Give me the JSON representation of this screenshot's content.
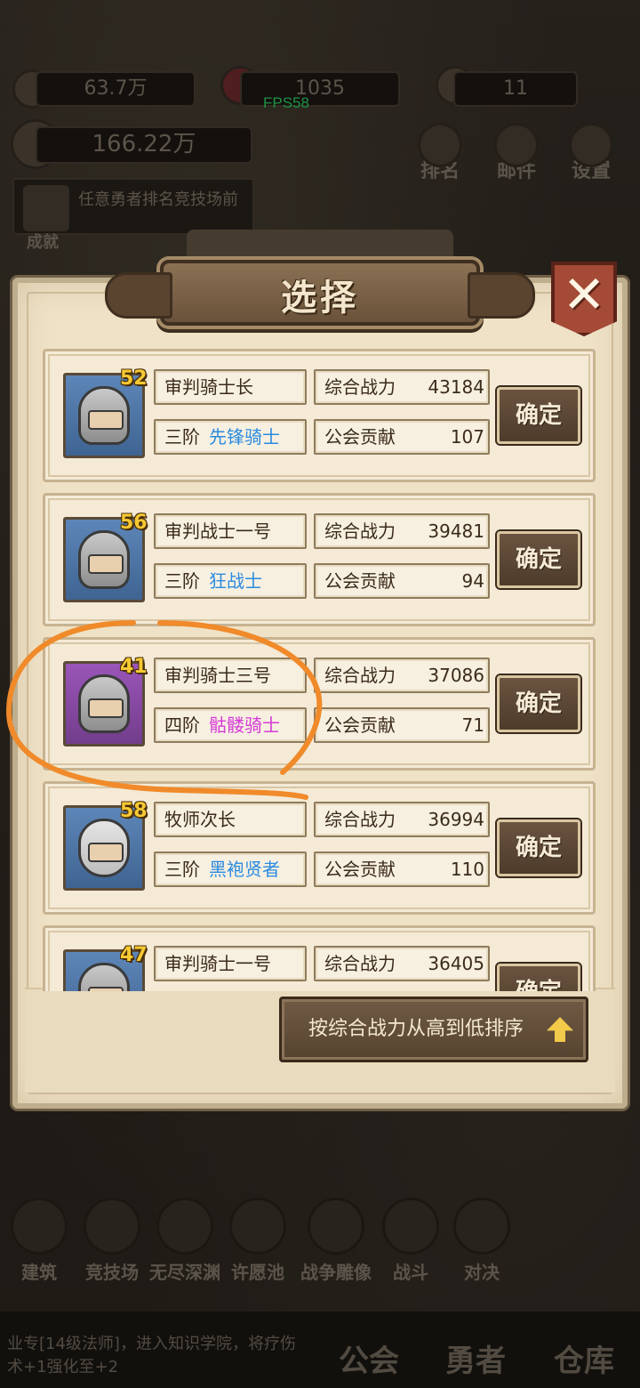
{
  "hud": {
    "gold": "63.7万",
    "gems": "1035",
    "third": "11",
    "fps": "FPS58",
    "power_total": "166.22万",
    "achievement_text": "任意勇者排名竞技场前",
    "achievement_label": "成就",
    "top_buttons": [
      "排名",
      "邮件",
      "设置"
    ]
  },
  "modal": {
    "title": "选择",
    "close_icon": "✕",
    "cards": [
      {
        "level": "52",
        "name": "审判骑士长",
        "rank": "三阶",
        "class": "先锋骑士",
        "class_color": "#2b8be0",
        "power_label": "综合战力",
        "power": "43184",
        "contrib_label": "公会贡献",
        "contrib": "107",
        "confirm": "确定",
        "frame": "blue"
      },
      {
        "level": "56",
        "name": "审判战士一号",
        "rank": "三阶",
        "class": "狂战士",
        "class_color": "#2b8be0",
        "power_label": "综合战力",
        "power": "39481",
        "contrib_label": "公会贡献",
        "contrib": "94",
        "confirm": "确定",
        "frame": "blue"
      },
      {
        "level": "41",
        "name": "审判骑士三号",
        "rank": "四阶",
        "class": "骷髅骑士",
        "class_color": "#d63ad8",
        "power_label": "综合战力",
        "power": "37086",
        "contrib_label": "公会贡献",
        "contrib": "71",
        "confirm": "确定",
        "frame": "purple"
      },
      {
        "level": "58",
        "name": "牧师次长",
        "rank": "三阶",
        "class": "黑袍贤者",
        "class_color": "#2b8be0",
        "power_label": "综合战力",
        "power": "36994",
        "contrib_label": "公会贡献",
        "contrib": "110",
        "confirm": "确定",
        "frame": "blue"
      },
      {
        "level": "47",
        "name": "审判骑士一号",
        "rank": "",
        "class": "",
        "class_color": "#2b8be0",
        "power_label": "综合战力",
        "power": "36405",
        "contrib_label": "",
        "contrib": "",
        "confirm": "确定",
        "frame": "blue"
      }
    ],
    "sort_button": "按综合战力从高到低排序"
  },
  "bottom_nav": [
    "建筑",
    "竞技场",
    "无尽深渊",
    "许愿池",
    "战争雕像",
    "战斗",
    "对决"
  ],
  "bottom_tabs": [
    "公会",
    "勇者",
    "仓库"
  ],
  "news": "业专[14级法师]，进入知识学院，将疗伤术+1强化至+2",
  "colors": {
    "annotation": "#f08a2a",
    "class_blue": "#2b8be0",
    "class_purple": "#d63ad8"
  }
}
